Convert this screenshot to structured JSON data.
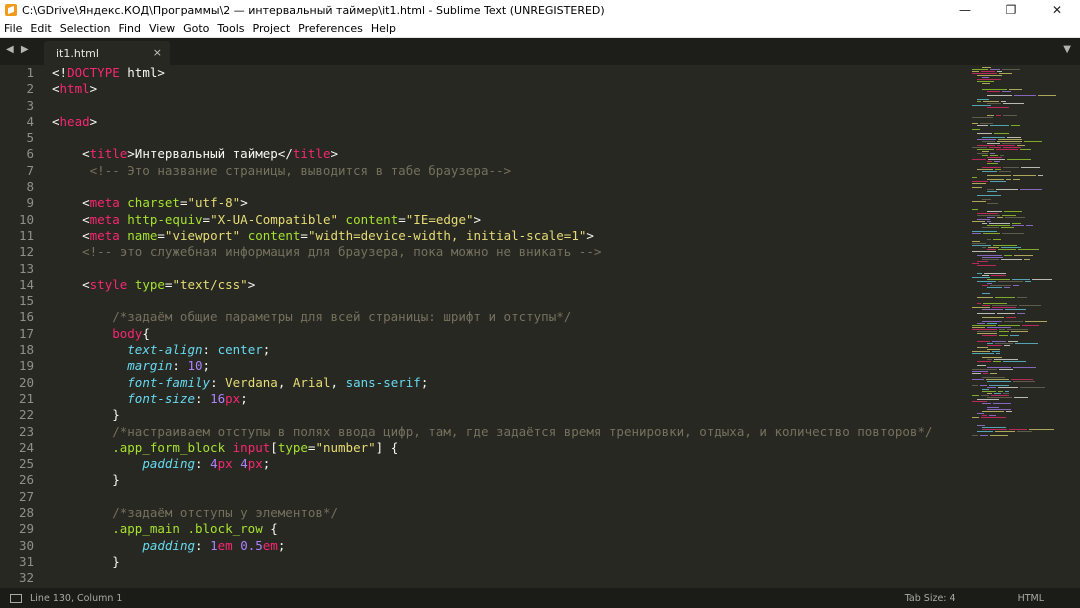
{
  "window": {
    "title": "C:\\GDrive\\Яндекс.КОД\\Программы\\2 — интервальный таймер\\it1.html - Sublime Text (UNREGISTERED)",
    "minimize": "—",
    "maximize": "❐",
    "close": "✕"
  },
  "menu": [
    "File",
    "Edit",
    "Selection",
    "Find",
    "View",
    "Goto",
    "Tools",
    "Project",
    "Preferences",
    "Help"
  ],
  "tabs": {
    "nav": "◀ ▶",
    "active": "it1.html",
    "close": "×",
    "dropdown": "▼"
  },
  "code": [
    [
      [
        "plain",
        "<!"
      ],
      [
        "tag",
        "DOCTYPE"
      ],
      [
        "plain",
        " html>"
      ]
    ],
    [
      [
        "plain",
        "<"
      ],
      [
        "tag",
        "html"
      ],
      [
        "plain",
        ">"
      ]
    ],
    [],
    [
      [
        "plain",
        "<"
      ],
      [
        "tag",
        "head"
      ],
      [
        "plain",
        ">"
      ]
    ],
    [],
    [
      [
        "plain",
        "    <"
      ],
      [
        "tag",
        "title"
      ],
      [
        "plain",
        ">Интервальный таймер</"
      ],
      [
        "tag",
        "title"
      ],
      [
        "plain",
        ">"
      ]
    ],
    [
      [
        "cmt",
        "     <!-- Это название страницы, выводится в табе браузера-->"
      ]
    ],
    [],
    [
      [
        "plain",
        "    <"
      ],
      [
        "tag",
        "meta"
      ],
      [
        "plain",
        " "
      ],
      [
        "attr",
        "charset"
      ],
      [
        "plain",
        "="
      ],
      [
        "str",
        "\"utf-8\""
      ],
      [
        "plain",
        ">"
      ]
    ],
    [
      [
        "plain",
        "    <"
      ],
      [
        "tag",
        "meta"
      ],
      [
        "plain",
        " "
      ],
      [
        "attr",
        "http-equiv"
      ],
      [
        "plain",
        "="
      ],
      [
        "str",
        "\"X-UA-Compatible\""
      ],
      [
        "plain",
        " "
      ],
      [
        "attr",
        "content"
      ],
      [
        "plain",
        "="
      ],
      [
        "str",
        "\"IE=edge\""
      ],
      [
        "plain",
        ">"
      ]
    ],
    [
      [
        "plain",
        "    <"
      ],
      [
        "tag",
        "meta"
      ],
      [
        "plain",
        " "
      ],
      [
        "attr",
        "name"
      ],
      [
        "plain",
        "="
      ],
      [
        "str",
        "\"viewport\""
      ],
      [
        "plain",
        " "
      ],
      [
        "attr",
        "content"
      ],
      [
        "plain",
        "="
      ],
      [
        "str",
        "\"width=device-width, initial-scale=1\""
      ],
      [
        "plain",
        ">"
      ]
    ],
    [
      [
        "cmt",
        "    <!-- это служебная информация для браузера, пока можно не вникать -->"
      ]
    ],
    [],
    [
      [
        "plain",
        "    <"
      ],
      [
        "tag",
        "style"
      ],
      [
        "plain",
        " "
      ],
      [
        "attr",
        "type"
      ],
      [
        "plain",
        "="
      ],
      [
        "str",
        "\"text/css\""
      ],
      [
        "plain",
        ">"
      ]
    ],
    [],
    [
      [
        "cmt",
        "        /*задаём общие параметры для всей страницы: шрифт и отступы*/"
      ]
    ],
    [
      [
        "plain",
        "        "
      ],
      [
        "tag",
        "body"
      ],
      [
        "plain",
        "{"
      ]
    ],
    [
      [
        "plain",
        "          "
      ],
      [
        "prop",
        "text-align"
      ],
      [
        "plain",
        ": "
      ],
      [
        "val",
        "center"
      ],
      [
        "plain",
        ";"
      ]
    ],
    [
      [
        "plain",
        "          "
      ],
      [
        "prop",
        "margin"
      ],
      [
        "plain",
        ": "
      ],
      [
        "num",
        "10"
      ],
      [
        "plain",
        ";"
      ]
    ],
    [
      [
        "plain",
        "          "
      ],
      [
        "prop",
        "font-family"
      ],
      [
        "plain",
        ": "
      ],
      [
        "str",
        "Verdana"
      ],
      [
        "plain",
        ", "
      ],
      [
        "str",
        "Arial"
      ],
      [
        "plain",
        ", "
      ],
      [
        "val",
        "sans-serif"
      ],
      [
        "plain",
        ";"
      ]
    ],
    [
      [
        "plain",
        "          "
      ],
      [
        "prop",
        "font-size"
      ],
      [
        "plain",
        ": "
      ],
      [
        "num",
        "16"
      ],
      [
        "unit",
        "px"
      ],
      [
        "plain",
        ";"
      ]
    ],
    [
      [
        "plain",
        "        }"
      ]
    ],
    [
      [
        "cmt",
        "        /*настраиваем отступы в полях ввода цифр, там, где задаётся время тренировки, отдыха, и количество повторов*/"
      ]
    ],
    [
      [
        "plain",
        "        "
      ],
      [
        "sel",
        ".app_form_block"
      ],
      [
        "plain",
        " "
      ],
      [
        "tag",
        "input"
      ],
      [
        "plain",
        "["
      ],
      [
        "attr",
        "type"
      ],
      [
        "plain",
        "="
      ],
      [
        "str",
        "\"number\""
      ],
      [
        "plain",
        "] {"
      ]
    ],
    [
      [
        "plain",
        "            "
      ],
      [
        "prop",
        "padding"
      ],
      [
        "plain",
        ": "
      ],
      [
        "num",
        "4"
      ],
      [
        "unit",
        "px"
      ],
      [
        "plain",
        " "
      ],
      [
        "num",
        "4"
      ],
      [
        "unit",
        "px"
      ],
      [
        "plain",
        ";"
      ]
    ],
    [
      [
        "plain",
        "        }"
      ]
    ],
    [],
    [
      [
        "cmt",
        "        /*задаём отступы у элементов*/"
      ]
    ],
    [
      [
        "plain",
        "        "
      ],
      [
        "sel",
        ".app_main .block_row"
      ],
      [
        "plain",
        " {"
      ]
    ],
    [
      [
        "plain",
        "            "
      ],
      [
        "prop",
        "padding"
      ],
      [
        "plain",
        ": "
      ],
      [
        "num",
        "1"
      ],
      [
        "unit",
        "em"
      ],
      [
        "plain",
        " "
      ],
      [
        "num",
        "0.5"
      ],
      [
        "unit",
        "em"
      ],
      [
        "plain",
        ";"
      ]
    ],
    [
      [
        "plain",
        "        }"
      ]
    ],
    []
  ],
  "status": {
    "position": "Line 130, Column 1",
    "tab_size": "Tab Size: 4",
    "syntax": "HTML"
  }
}
